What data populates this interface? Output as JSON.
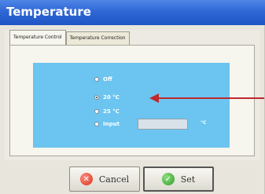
{
  "window": {
    "title": "Temperature"
  },
  "tabs": [
    {
      "label": "Temperature Control",
      "active": true
    },
    {
      "label": "Temperature Correction",
      "active": false
    }
  ],
  "options": [
    {
      "label": "Off",
      "checked": false
    },
    {
      "label": "20 °C",
      "checked": true
    },
    {
      "label": "25 °C",
      "checked": false
    },
    {
      "label": "Input",
      "checked": false
    }
  ],
  "input": {
    "value": "",
    "unit": "°C"
  },
  "buttons": {
    "cancel_label": "Cancel",
    "set_label": "Set"
  },
  "colors": {
    "titlebar": "#2f67d6",
    "panel_accent": "#6cc4f0",
    "arrow": "#c0292c"
  },
  "icons": {
    "cancel": "cancel-x-icon",
    "set": "checkmark-icon"
  }
}
